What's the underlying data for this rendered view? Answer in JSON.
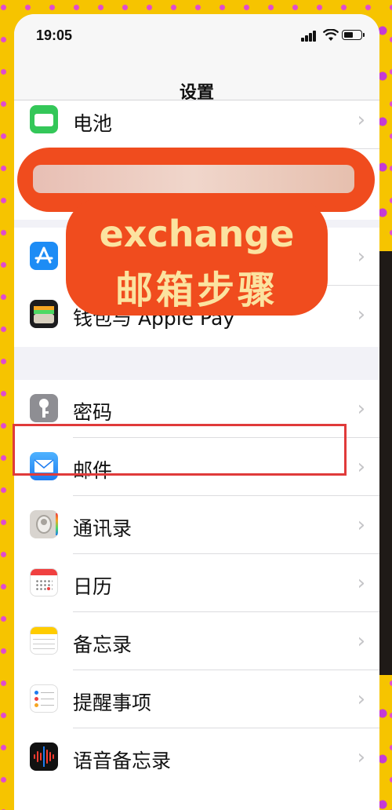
{
  "status": {
    "time": "19:05"
  },
  "nav": {
    "title": "设置"
  },
  "overlay": {
    "line1": "exchange",
    "line2": "邮箱步骤"
  },
  "rows": {
    "battery": "电池",
    "appstore": "A",
    "wallet": "钱包与 Apple Pay",
    "passwords": "密码",
    "mail": "邮件",
    "contacts": "通讯录",
    "calendar": "日历",
    "notes": "备忘录",
    "reminders": "提醒事项",
    "voicememos": "语音备忘录"
  },
  "chevron": "›",
  "colors": {
    "highlight": "#e03a3a",
    "overlay": "#f04c1e",
    "overlay_text": "#fbe3a0"
  }
}
